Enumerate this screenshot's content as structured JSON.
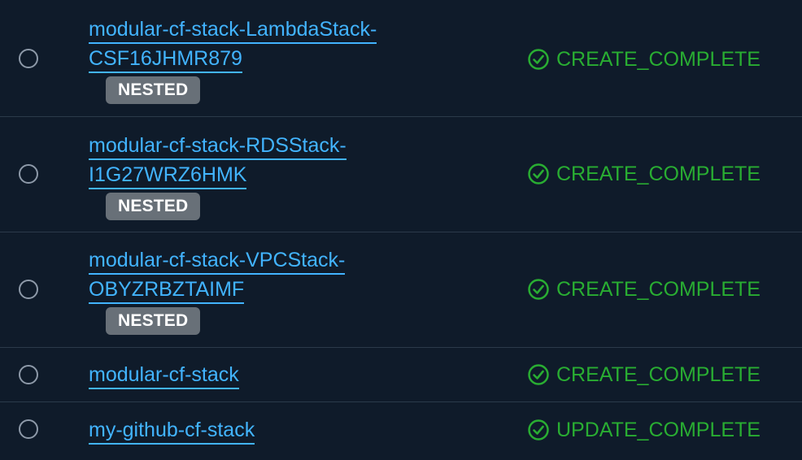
{
  "stacks": [
    {
      "name_line1": "modular-cf-stack-LambdaStack-",
      "name_line2": "CSF16JHMR879",
      "badge": "NESTED",
      "status": "CREATE_COMPLETE"
    },
    {
      "name_line1": "modular-cf-stack-RDSStack-",
      "name_line2": "I1G27WRZ6HMK",
      "badge": "NESTED",
      "status": "CREATE_COMPLETE"
    },
    {
      "name_line1": "modular-cf-stack-VPCStack-",
      "name_line2": "OBYZRBZTAIMF",
      "badge": "NESTED",
      "status": "CREATE_COMPLETE"
    },
    {
      "name_line1": "modular-cf-stack",
      "status": "CREATE_COMPLETE"
    },
    {
      "name_line1": "my-github-cf-stack",
      "status": "UPDATE_COMPLETE"
    }
  ],
  "icons": {
    "radio": "radio-button-icon",
    "status": "check-circle-icon"
  },
  "colors": {
    "background": "#0f1b2a",
    "link": "#42b4ff",
    "success": "#29ad32",
    "badge": "#687078",
    "divider": "#2b3a4a"
  }
}
